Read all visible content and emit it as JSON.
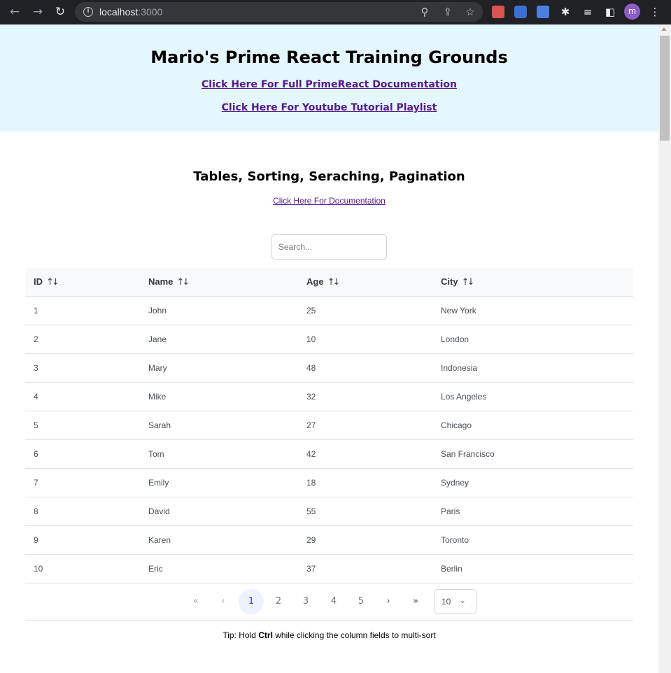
{
  "browser": {
    "url_host": "localhost",
    "url_port": ":3000",
    "profile_initial": "m"
  },
  "hero": {
    "title": "Mario's Prime React Training Grounds",
    "link_docs": "Click Here For Full PrimeReact Documentation",
    "link_youtube": "Click Here For Youtube Tutorial Playlist"
  },
  "section": {
    "title": "Tables, Sorting, Seraching, Pagination",
    "doc_link": "Click Here For Documentation"
  },
  "search": {
    "placeholder": "Search..."
  },
  "table": {
    "columns": [
      "ID",
      "Name",
      "Age",
      "City"
    ],
    "rows": [
      [
        "1",
        "John",
        "25",
        "New York"
      ],
      [
        "2",
        "Jane",
        "10",
        "London"
      ],
      [
        "3",
        "Mary",
        "48",
        "Indonesia"
      ],
      [
        "4",
        "Mike",
        "32",
        "Los Angeles"
      ],
      [
        "5",
        "Sarah",
        "27",
        "Chicago"
      ],
      [
        "6",
        "Tom",
        "42",
        "San Francisco"
      ],
      [
        "7",
        "Emily",
        "18",
        "Sydney"
      ],
      [
        "8",
        "David",
        "55",
        "Paris"
      ],
      [
        "9",
        "Karen",
        "29",
        "Toronto"
      ],
      [
        "10",
        "Eric",
        "37",
        "Berlin"
      ]
    ]
  },
  "paginator": {
    "first": "«",
    "prev": "‹",
    "pages": [
      "1",
      "2",
      "3",
      "4",
      "5"
    ],
    "current_page": "1",
    "next": "›",
    "last": "»",
    "rows_per_page": "10"
  },
  "tip": {
    "before": "Tip: Hold ",
    "key": "Ctrl",
    "after": " while clicking the column fields to multi-sort"
  },
  "colors": {
    "hero_bg": "#e4f6fe",
    "link": "#551a8b",
    "active_page_bg": "#eef2ff"
  }
}
